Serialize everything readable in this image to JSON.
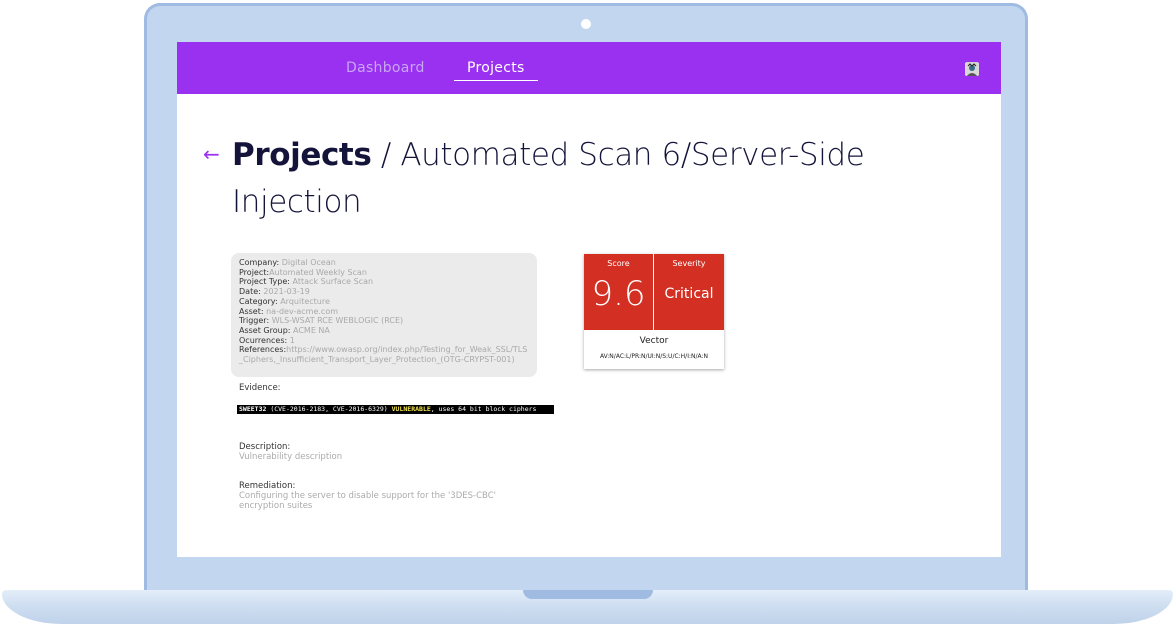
{
  "nav": {
    "items": [
      {
        "label": "Dashboard",
        "active": false
      },
      {
        "label": "Projects",
        "active": true
      }
    ]
  },
  "header": {
    "breadcrumb_root": "Projects",
    "separator": " / ",
    "title": "Automated Scan 6/Server-Side Injection"
  },
  "details": [
    {
      "label": "Company:",
      "value": " Digital Ocean"
    },
    {
      "label": "Project:",
      "value": "Automated Weekly Scan"
    },
    {
      "label": "Project Type:",
      "value": " Attack Surface Scan"
    },
    {
      "label": "Date:",
      "value": " 2021-03-19"
    },
    {
      "label": "Category:",
      "value": " Arquitecture"
    },
    {
      "label": "Asset:",
      "value": " na-dev-acme.com"
    },
    {
      "label": "Trigger:",
      "value": " WLS-WSAT RCE WEBLOGIC (RCE)"
    },
    {
      "label": "Asset Group:",
      "value": " ACME NA"
    },
    {
      "label": "Ocurrences:",
      "value": " 1"
    },
    {
      "label": "References:",
      "value": "https://www.owasp.org/index.php/Testing_for_Weak_SSL/TLS_Ciphers,_Insufficient_Transport_Layer_Protection_(OTG-CRYPST-001)"
    }
  ],
  "evidence": {
    "label": "Evidence:",
    "line_prefix": " SWEET32 ",
    "line_cves": "(CVE-2016-2183, CVE-2016-6329)    ",
    "line_status": "VULNERABLE",
    "line_rest": ", uses 64 bit block ciphers"
  },
  "description": {
    "label": "Description:",
    "value": "Vulnerability description"
  },
  "remediation": {
    "label": "Remediation:",
    "value": "Configuring the server to disable support for the '3DES-CBC' encryption suites"
  },
  "score_card": {
    "score_label": "Score",
    "score": "9.6",
    "severity_label": "Severity",
    "severity": "Critical",
    "vector_label": "Vector",
    "vector": "AV:N/AC:L/PR:N/UI:N/S:U/C:H/I:N/A:N",
    "color": "#d33023"
  },
  "colors": {
    "accent": "#9a30f0",
    "frame": "#c2d6f0"
  },
  "icons": {
    "back": "arrow-left-icon",
    "avatar": "user-avatar"
  }
}
